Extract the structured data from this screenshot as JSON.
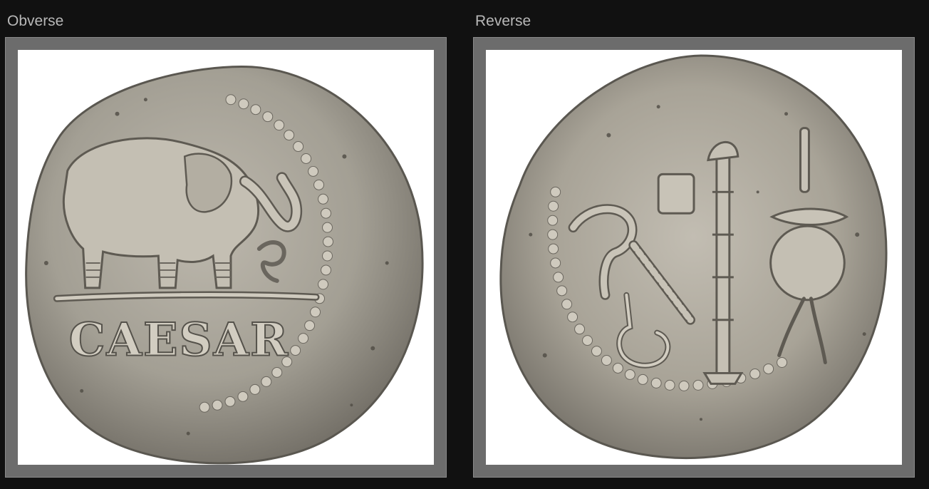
{
  "panels": {
    "obverse": {
      "label": "Obverse",
      "legend": "CAESAR",
      "image_subject": "elephant-coin-icon"
    },
    "reverse": {
      "label": "Reverse",
      "image_subject": "priestly-implements-coin-icon"
    }
  },
  "colors": {
    "background": "#111111",
    "frame": "#6c6c6c",
    "label": "#b8b8b8",
    "coin_silver": "#a8a397"
  }
}
